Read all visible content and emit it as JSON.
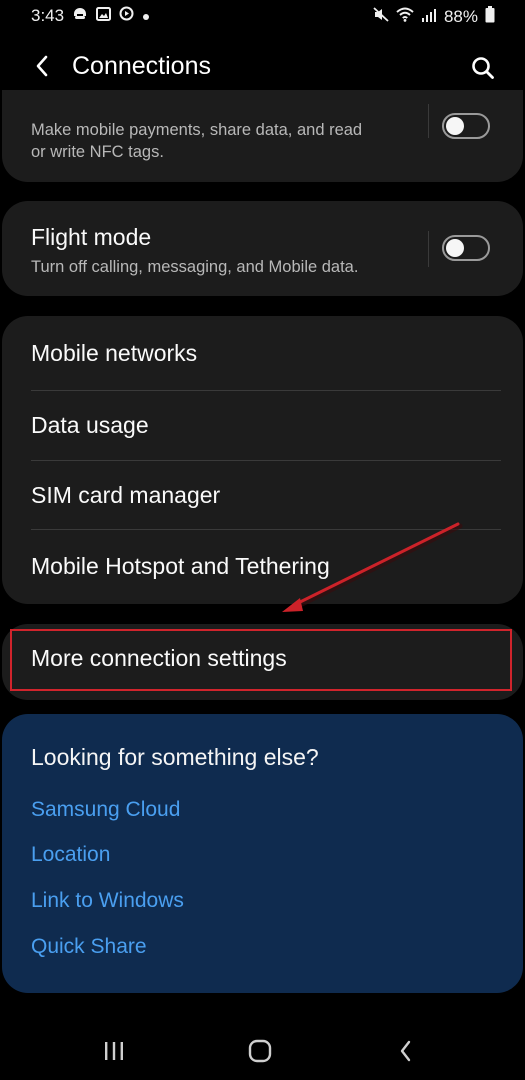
{
  "status_bar": {
    "time": "3:43",
    "battery": "88%",
    "left_icons": [
      "messenger-icon",
      "gallery-icon",
      "media-icon",
      "dot-icon"
    ],
    "right_icons": [
      "mute-icon",
      "wifi-icon",
      "signal-icon",
      "battery-icon"
    ]
  },
  "header": {
    "title": "Connections"
  },
  "nfc": {
    "subtitle_line1": "Make mobile payments, share data, and read",
    "subtitle_line2": "or write NFC tags.",
    "enabled": false
  },
  "flight_mode": {
    "title": "Flight mode",
    "subtitle": "Turn off calling, messaging, and Mobile data.",
    "enabled": false
  },
  "group_items": [
    {
      "label": "Mobile networks"
    },
    {
      "label": "Data usage"
    },
    {
      "label": "SIM card manager"
    },
    {
      "label": "Mobile Hotspot and Tethering"
    }
  ],
  "more": {
    "label": "More connection settings"
  },
  "suggest": {
    "title": "Looking for something else?",
    "links": [
      "Samsung Cloud",
      "Location",
      "Link to Windows",
      "Quick Share"
    ]
  },
  "colors": {
    "background": "#000000",
    "card": "#1c1c1c",
    "suggest_card": "#0f2b4f",
    "link": "#4a9ff0",
    "annotation_red": "#d0242c"
  }
}
